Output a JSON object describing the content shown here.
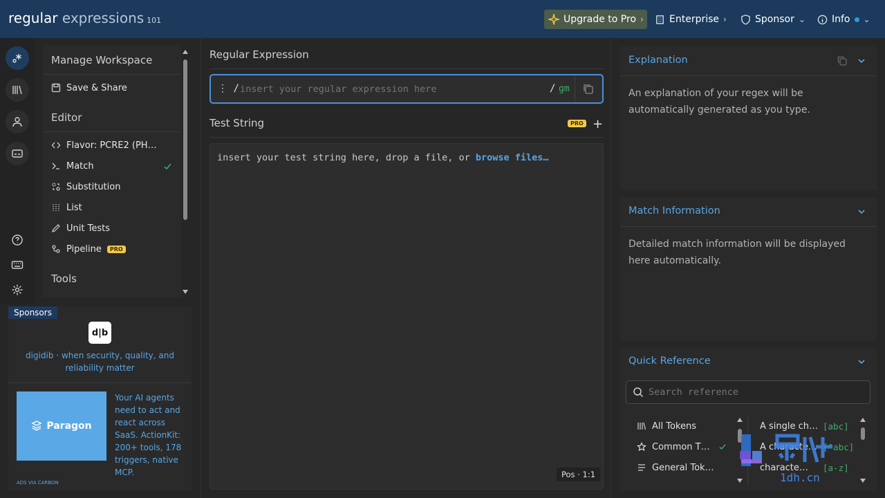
{
  "header": {
    "logo_main": "regular",
    "logo_sub": "expressions",
    "logo_version": "101",
    "upgrade_label": "Upgrade to Pro",
    "enterprise_label": "Enterprise",
    "sponsor_label": "Sponsor",
    "info_label": "Info"
  },
  "sidebar": {
    "manage_heading": "Manage Workspace",
    "save_share": "Save & Share",
    "editor_heading": "Editor",
    "items": [
      {
        "label": "Flavor: PCRE2 (PH…"
      },
      {
        "label": "Match"
      },
      {
        "label": "Substitution"
      },
      {
        "label": "List"
      },
      {
        "label": "Unit Tests"
      },
      {
        "label": "Pipeline"
      }
    ],
    "pro_badge": "PRO",
    "tools_heading": "Tools"
  },
  "sponsors": {
    "tab_label": "Sponsors",
    "digidib_logo": "d|b",
    "digidib_text": "digidib · when security, quality, and reliability matter",
    "paragon_name": "Paragon",
    "paragon_text": "Your AI agents need to act and react across SaaS. ActionKit: 200+ tools, 178 triggers, native MCP.",
    "ads_label": "ADS VIA CARBON"
  },
  "main": {
    "regex_title": "Regular Expression",
    "regex_delim_start": "/",
    "regex_placeholder": "insert your regular expression here",
    "regex_delim_end": "/",
    "regex_flags": "gm",
    "test_title": "Test String",
    "test_pro": "PRO",
    "test_placeholder": "insert your test string here, drop a file, or",
    "test_link": "browse files…",
    "pos_label": "Pos · 1:1"
  },
  "explanation": {
    "title": "Explanation",
    "body": "An explanation of your regex will be automatically generated as you type."
  },
  "match_info": {
    "title": "Match Information",
    "body": "Detailed match information will be displayed here automatically."
  },
  "quick_reference": {
    "title": "Quick Reference",
    "search_placeholder": "Search reference",
    "categories": [
      {
        "label": "All Tokens"
      },
      {
        "label": "Common T…"
      },
      {
        "label": "General Tok…"
      }
    ],
    "tokens": [
      {
        "label": "A single ch…",
        "code": "[abc]"
      },
      {
        "label": "A characte…",
        "code": "[^abc]"
      },
      {
        "label": "characte…",
        "code": "[a-z]"
      }
    ]
  },
  "watermark": {
    "text": "1dh.cn"
  },
  "colors": {
    "accent": "#58a6e6",
    "header": "#1b3a5c",
    "flags": "#3fae6a",
    "pro": "#f2c94c"
  }
}
